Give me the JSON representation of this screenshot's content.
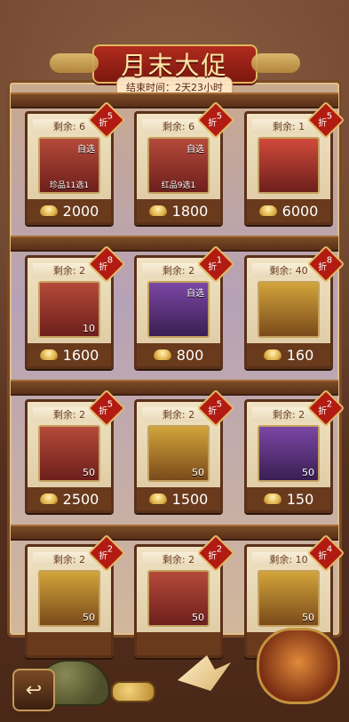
{
  "header": {
    "title": "月末大促",
    "countdown_label": "结束时间：2天23小时"
  },
  "rows": [
    {
      "cards": [
        {
          "remaining": "剩余: 6",
          "discount_top": "5",
          "discount_bottom": "折",
          "price": "2000",
          "image": {
            "theme": "red",
            "badge": "自选",
            "caption": "珍品11选1"
          }
        },
        {
          "remaining": "剩余: 6",
          "discount_top": "5",
          "discount_bottom": "折",
          "price": "1800",
          "image": {
            "theme": "red",
            "badge": "自选",
            "caption": "红品9选1"
          }
        },
        {
          "remaining": "剩余: 1",
          "discount_top": "5",
          "discount_bottom": "折",
          "price": "6000",
          "image": {
            "theme": "red2",
            "badge": "",
            "caption": ""
          }
        }
      ]
    },
    {
      "cards": [
        {
          "remaining": "剩余: 2",
          "discount_top": "8",
          "discount_bottom": "折",
          "price": "1600",
          "image": {
            "theme": "red",
            "badge": "",
            "caption": "",
            "qty": "10"
          }
        },
        {
          "remaining": "剩余: 2",
          "discount_top": "1",
          "discount_bottom": "折",
          "price": "800",
          "image": {
            "theme": "purple",
            "badge": "自选",
            "caption": ""
          }
        },
        {
          "remaining": "剩余: 40",
          "discount_top": "8",
          "discount_bottom": "折",
          "price": "160",
          "image": {
            "theme": "gold",
            "badge": "",
            "caption": ""
          }
        }
      ]
    },
    {
      "cards": [
        {
          "remaining": "剩余: 2",
          "discount_top": "5",
          "discount_bottom": "折",
          "price": "2500",
          "image": {
            "theme": "red",
            "badge": "",
            "caption": "",
            "qty": "50"
          }
        },
        {
          "remaining": "剩余: 2",
          "discount_top": "5",
          "discount_bottom": "折",
          "price": "1500",
          "image": {
            "theme": "gold",
            "badge": "",
            "caption": "",
            "qty": "50"
          }
        },
        {
          "remaining": "剩余: 2",
          "discount_top": "2",
          "discount_bottom": "折",
          "price": "150",
          "image": {
            "theme": "purple",
            "badge": "",
            "caption": "",
            "qty": "50"
          }
        }
      ]
    },
    {
      "cards": [
        {
          "remaining": "剩余: 2",
          "discount_top": "2",
          "discount_bottom": "折",
          "price": "",
          "image": {
            "theme": "gold",
            "badge": "",
            "caption": "",
            "qty": "50"
          }
        },
        {
          "remaining": "剩余: 2",
          "discount_top": "2",
          "discount_bottom": "折",
          "price": "",
          "image": {
            "theme": "red",
            "badge": "",
            "caption": "",
            "qty": "50"
          }
        },
        {
          "remaining": "剩余: 10",
          "discount_top": "4",
          "discount_bottom": "折",
          "price": "",
          "image": {
            "theme": "gold",
            "badge": "",
            "caption": "",
            "qty": "50"
          }
        }
      ]
    }
  ],
  "controls": {
    "back_icon": "back-arrow-icon"
  },
  "colors": {
    "banner_red": "#b12b1d",
    "gold": "#e0b65a",
    "card_bg": "#f0e2c2",
    "price_bar": "#6a3a1d"
  }
}
